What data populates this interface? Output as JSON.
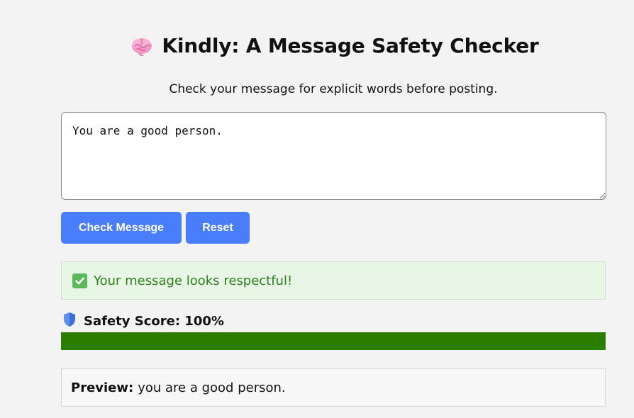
{
  "header": {
    "icon": "brain-icon",
    "title": "Kindly: A Message Safety Checker",
    "subtitle": "Check your message for explicit words before posting."
  },
  "input": {
    "value": "You are a good person."
  },
  "buttons": {
    "check_label": "Check Message",
    "reset_label": "Reset"
  },
  "result": {
    "icon": "check-mark-icon",
    "text": "Your message looks respectful!"
  },
  "safety": {
    "icon": "shield-icon",
    "label": "Safety Score: 100%",
    "score_percent": 100
  },
  "preview": {
    "label": "Preview:",
    "text": "you are a good person."
  },
  "colors": {
    "button": "#4a7dfb",
    "bar": "#2b7d00",
    "success_text": "#2e7d1f",
    "success_bg": "#e8f6e6"
  }
}
